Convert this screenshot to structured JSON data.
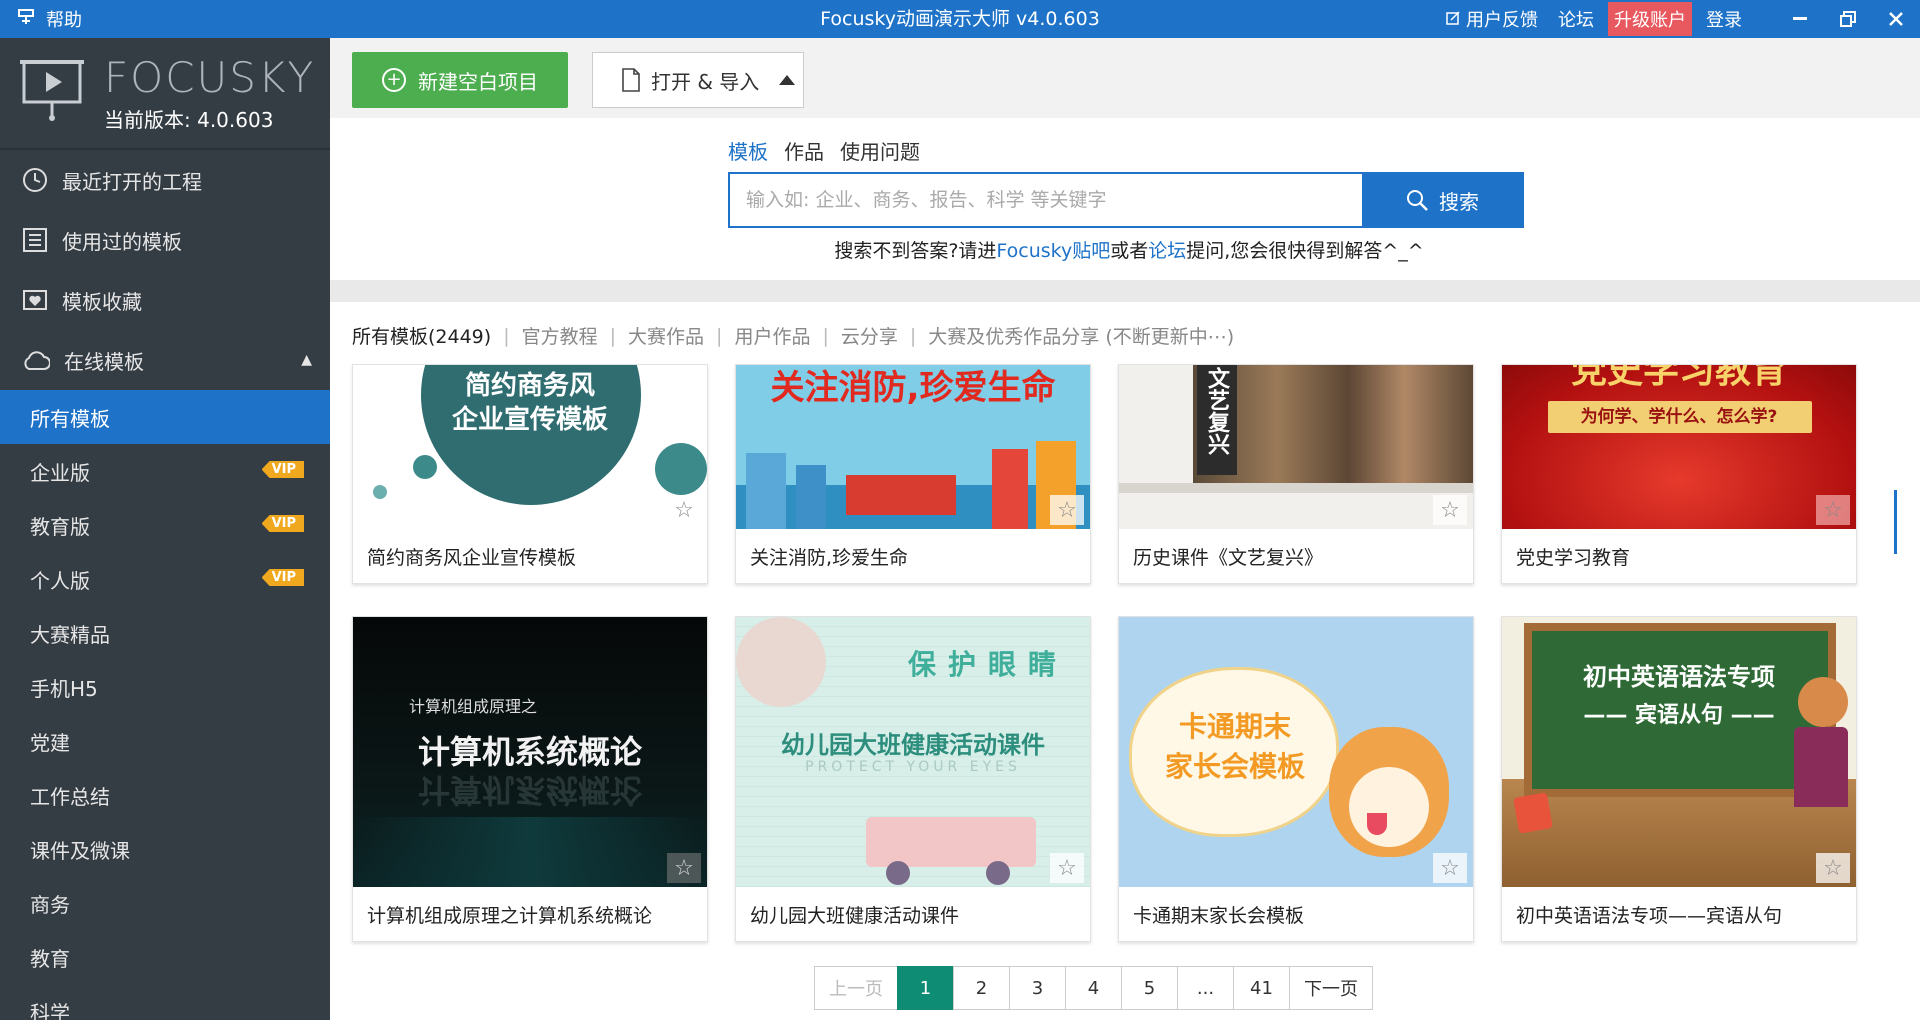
{
  "titlebar": {
    "help": "帮助",
    "title": "Focusky动画演示大师 v4.0.603",
    "feedback": "用户反馈",
    "forum": "论坛",
    "upgrade": "升级账户",
    "login": "登录",
    "bg_color": "#1e73c8"
  },
  "sidebar": {
    "logo_word": "FOCUSKY",
    "version_label": "当前版本: 4.0.603",
    "top_items": [
      {
        "label": "最近打开的工程",
        "icon": "clock-icon"
      },
      {
        "label": "使用过的模板",
        "icon": "list-icon"
      },
      {
        "label": "模板收藏",
        "icon": "heart-icon"
      },
      {
        "label": "在线模板",
        "icon": "cloud-icon"
      }
    ],
    "categories": [
      {
        "label": "所有模板",
        "vip": ""
      },
      {
        "label": "企业版",
        "vip": "VIP"
      },
      {
        "label": "教育版",
        "vip": "VIP"
      },
      {
        "label": "个人版",
        "vip": "VIP"
      },
      {
        "label": "大赛精品",
        "vip": ""
      },
      {
        "label": "手机H5",
        "vip": ""
      },
      {
        "label": "党建",
        "vip": ""
      },
      {
        "label": "工作总结",
        "vip": ""
      },
      {
        "label": "课件及微课",
        "vip": ""
      },
      {
        "label": "商务",
        "vip": ""
      },
      {
        "label": "教育",
        "vip": ""
      },
      {
        "label": "科学",
        "vip": ""
      }
    ],
    "active_category": "所有模板",
    "active_color": "#1e73c8"
  },
  "toolbar": {
    "new_label": "新建空白项目",
    "open_label": "打开 & 导入"
  },
  "search": {
    "tabs": [
      "模板",
      "作品",
      "使用问题"
    ],
    "active_tab": "模板",
    "placeholder": "输入如: 企业、商务、报告、科学 等关键字",
    "button": "搜索",
    "hint_prefix": "搜索不到答案?请进",
    "hint_link1": "Focusky贴吧",
    "hint_mid": "或者",
    "hint_link2": "论坛",
    "hint_suffix": "提问,您会很快得到解答^_^"
  },
  "filters": {
    "items": [
      "所有模板(2449)",
      "官方教程",
      "大赛作品",
      "用户作品",
      "云分享",
      "大赛及优秀作品分享 (不断更新中⋯)"
    ]
  },
  "cards": [
    {
      "title": "简约商务风企业宣传模板",
      "thumb_text": "简约商务风\n企业宣传模板"
    },
    {
      "title": "关注消防,珍爱生命",
      "thumb_text": "关注消防,珍爱生命"
    },
    {
      "title": "历史课件《文艺复兴》",
      "thumb_text": "文艺复兴"
    },
    {
      "title": "党史学习教育",
      "thumb_text": "党史学习教育",
      "thumb_sub": "为何学、学什么、怎么学?"
    },
    {
      "title": "计算机组成原理之计算机系统概论",
      "thumb_text": "计算机系统概论",
      "thumb_sub": "计算机组成原理之"
    },
    {
      "title": "幼儿园大班健康活动课件",
      "thumb_text": "幼儿园大班健康活动课件",
      "thumb_sub": "保护眼睛",
      "thumb_en": "PROTECT YOUR EYES"
    },
    {
      "title": "卡通期末家长会模板",
      "thumb_text": "卡通期末\n家长会模板"
    },
    {
      "title": "初中英语语法专项——宾语从句",
      "thumb_text": "初中英语语法专项",
      "thumb_sub": "—— 宾语从句 ——"
    }
  ],
  "pagination": {
    "prev": "上一页",
    "pages": [
      "1",
      "2",
      "3",
      "4",
      "5",
      "...",
      "41"
    ],
    "current": "1",
    "next": "下一页",
    "active_color": "#0f8d74"
  }
}
